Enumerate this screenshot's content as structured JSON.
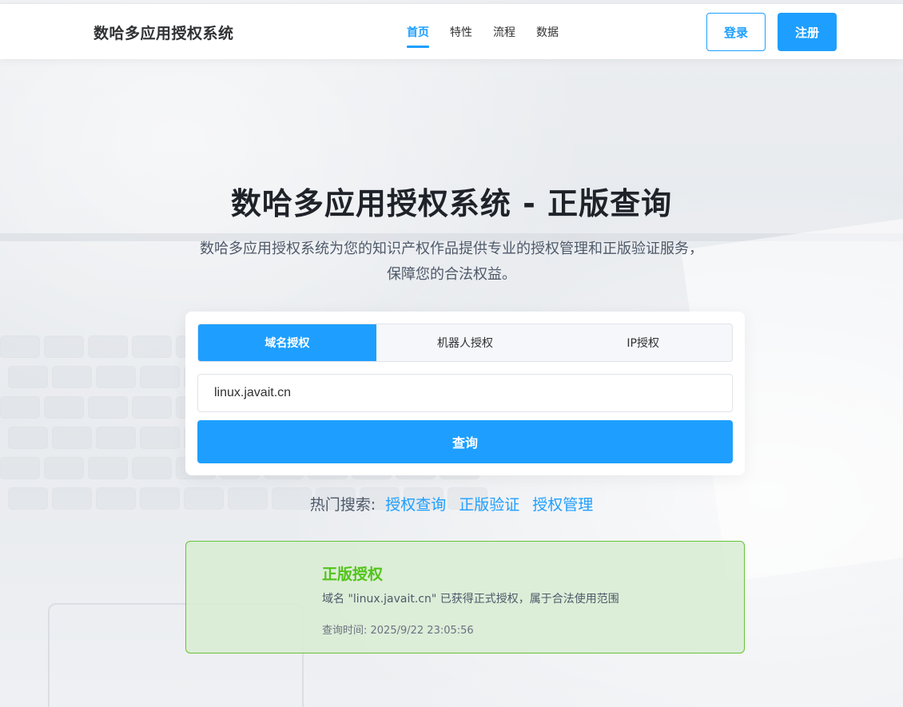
{
  "header": {
    "brand": "数哈多应用授权系统",
    "nav": [
      "首页",
      "特性",
      "流程",
      "数据"
    ],
    "login_label": "登录",
    "register_label": "注册"
  },
  "hero": {
    "title": "数哈多应用授权系统 - 正版查询",
    "subtitle_line1": "数哈多应用授权系统为您的知识产权作品提供专业的授权管理和正版验证服务，",
    "subtitle_line2": "保障您的合法权益。"
  },
  "search": {
    "tabs": [
      "域名授权",
      "机器人授权",
      "IP授权"
    ],
    "active_tab": 0,
    "input_value": "linux.javait.cn",
    "submit_label": "查询"
  },
  "hot": {
    "label": "热门搜索:",
    "links": [
      "授权查询",
      "正版验证",
      "授权管理"
    ]
  },
  "result": {
    "title": "正版授权",
    "message": "域名 \"linux.javait.cn\" 已获得正式授权，属于合法使用范围",
    "time": "查询时间: 2025/9/22 23:05:56"
  },
  "colors": {
    "accent": "#1e9fff",
    "success": "#52c41a"
  }
}
